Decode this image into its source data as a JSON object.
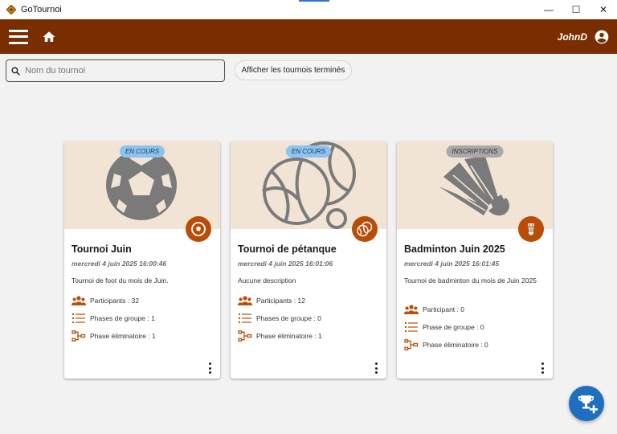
{
  "window": {
    "title": "GoTournoi",
    "controls": {
      "minimize": "—",
      "maximize": "☐",
      "close": "✕"
    }
  },
  "appbar": {
    "menu_icon": "hamburger-menu-icon",
    "home_icon": "home-icon",
    "username": "JohnD",
    "account_icon": "account-circle-icon",
    "color": "#7a2e00"
  },
  "search": {
    "placeholder": "Nom du tournoi",
    "value": ""
  },
  "filters": {
    "show_finished_label": "Afficher les tournois terminés"
  },
  "tournaments": [
    {
      "status": "EN COURS",
      "sport_icon": "soccer-ball-icon",
      "name": "Tournoi Juin",
      "date": "mercredi 4 juin 2025 16:00:46",
      "description": "Tournoi de foot du mois de Juin.",
      "participants": "Participants : 32",
      "group_phases": "Phases de groupe : 1",
      "knockout_phase": "Phase éliminatoire : 1"
    },
    {
      "status": "EN COURS",
      "sport_icon": "petanque-balls-icon",
      "name": "Tournoi de pétanque",
      "date": "mercredi 4 juin 2025 16:01:06",
      "description": "Aucune description",
      "participants": "Participants : 12",
      "group_phases": "Phases de groupe : 0",
      "knockout_phase": "Phase éliminatoire : 1"
    },
    {
      "status": "INSCRIPTIONS",
      "sport_icon": "shuttlecock-icon",
      "name": "Badminton Juin 2025",
      "date": "mercredi 4 juin 2025 16:01:45",
      "description": "Tournoi de badminton du mois de Juin 2025",
      "participants": "Participant : 0",
      "group_phases": "Phase de groupe : 0",
      "knockout_phase": "Phase éliminatoire : 0"
    }
  ],
  "colors": {
    "banner": "#f1e4d4",
    "sport_icon_bg": "#b94d08",
    "status_running": "#8ec3ee",
    "status_registration": "#a9a9a9",
    "fab": "#1f6fbf"
  },
  "fab": {
    "icon": "add-tournament-trophy-icon"
  }
}
